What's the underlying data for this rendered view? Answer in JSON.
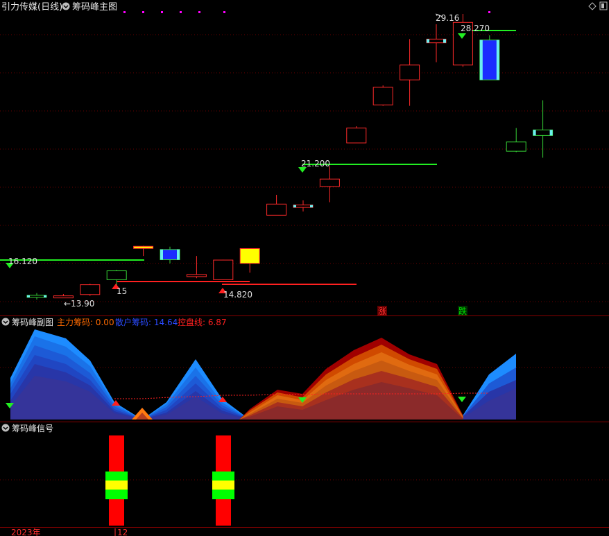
{
  "header": {
    "title": "引力传媒(日线)",
    "indicator_name": "筹码峰主图",
    "right_icons": [
      "diamond-icon",
      "window-icon"
    ]
  },
  "main_chart": {
    "candles": [
      {
        "o": 13.9,
        "h": 14.1,
        "l": 13.75,
        "c": 13.98,
        "up": false,
        "style": "cyan_edge"
      },
      {
        "o": 13.92,
        "h": 14.05,
        "l": 13.85,
        "c": 13.95,
        "up": true,
        "style": "normal"
      },
      {
        "o": 14.02,
        "h": 14.6,
        "l": 13.95,
        "c": 14.55,
        "up": true,
        "style": "normal"
      },
      {
        "o": 14.82,
        "h": 15.35,
        "l": 14.5,
        "c": 15.3,
        "up": false,
        "style": "hollow_green"
      },
      {
        "o": 16.6,
        "h": 16.65,
        "l": 16.1,
        "c": 16.62,
        "up": true,
        "style": "yellow_dash"
      },
      {
        "o": 16.45,
        "h": 16.6,
        "l": 15.7,
        "c": 15.9,
        "up": false,
        "style": "blue_solid"
      },
      {
        "o": 15.0,
        "h": 16.1,
        "l": 14.9,
        "c": 15.1,
        "up": true,
        "style": "normal"
      },
      {
        "o": 14.82,
        "h": 15.9,
        "l": 14.8,
        "c": 15.88,
        "up": true,
        "style": "normal"
      },
      {
        "o": 15.7,
        "h": 16.5,
        "l": 15.2,
        "c": 16.5,
        "up": true,
        "style": "yellow_solid"
      },
      {
        "o": 18.9,
        "h": 19.4,
        "l": 18.3,
        "c": 18.3,
        "up": true,
        "style": "red_hollow"
      },
      {
        "o": 18.85,
        "h": 19.1,
        "l": 18.5,
        "c": 18.72,
        "up": true,
        "style": "cyan_edge_red"
      },
      {
        "o": 20.25,
        "h": 20.95,
        "l": 19.0,
        "c": 19.85,
        "up": true,
        "style": "red_hollow"
      },
      {
        "o": 23.0,
        "h": 23.1,
        "l": 22.2,
        "c": 22.2,
        "up": true,
        "style": "red_hollow"
      },
      {
        "o": 25.2,
        "h": 25.3,
        "l": 24.2,
        "c": 24.25,
        "up": true,
        "style": "red_hollow"
      },
      {
        "o": 26.4,
        "h": 27.8,
        "l": 24.2,
        "c": 25.6,
        "up": true,
        "style": "red_hollow"
      },
      {
        "o": 27.8,
        "h": 28.6,
        "l": 26.55,
        "c": 27.6,
        "up": true,
        "style": "cyan_edge_red"
      },
      {
        "o": 28.7,
        "h": 29.16,
        "l": 26.3,
        "c": 26.4,
        "up": true,
        "style": "red_hollow"
      },
      {
        "o": 27.75,
        "h": 28.0,
        "l": 26.5,
        "c": 25.6,
        "up": false,
        "style": "blue_solid"
      },
      {
        "o": 22.25,
        "h": 23.0,
        "l": 21.7,
        "c": 21.75,
        "up": false,
        "style": "hollow_green"
      },
      {
        "o": 22.9,
        "h": 24.5,
        "l": 21.4,
        "c": 22.6,
        "up": false,
        "style": "cyan_edge"
      }
    ],
    "annotations": [
      {
        "text": "16.120",
        "kind": "resistance_label"
      },
      {
        "text": "←13.90",
        "kind": "low_label"
      },
      {
        "text": "15",
        "kind": "support_label"
      },
      {
        "text": "14.820",
        "kind": "support_label"
      },
      {
        "text": "21.200",
        "kind": "resistance_label"
      },
      {
        "text": "28.270",
        "kind": "resistance_label"
      },
      {
        "text": "29.16",
        "kind": "high_label"
      }
    ],
    "tags": [
      {
        "text": "涨",
        "color": "#ff3030"
      },
      {
        "text": "跌",
        "color": "#00e000"
      }
    ]
  },
  "sub_chart": {
    "name": "筹码峰副图",
    "legend": [
      {
        "label": "主力筹码: 0.00",
        "color": "#ff6a00"
      },
      {
        "label": "散户筹码: 14.64",
        "color": "#2a4bff"
      },
      {
        "label": "控盘线: 6.87",
        "color": "#ff2020"
      }
    ]
  },
  "signal_chart": {
    "name": "筹码峰信号"
  },
  "xaxis": {
    "labels": [
      "2023年",
      "12"
    ]
  },
  "colors": {
    "up": "#ff2a2a",
    "down": "#36d236",
    "cyan": "#6cf0f0",
    "blue": "#1b2cff",
    "yellow": "#ffff00",
    "grid": "#5a0000",
    "line_green": "#22ee22",
    "line_red": "#ff2020"
  }
}
